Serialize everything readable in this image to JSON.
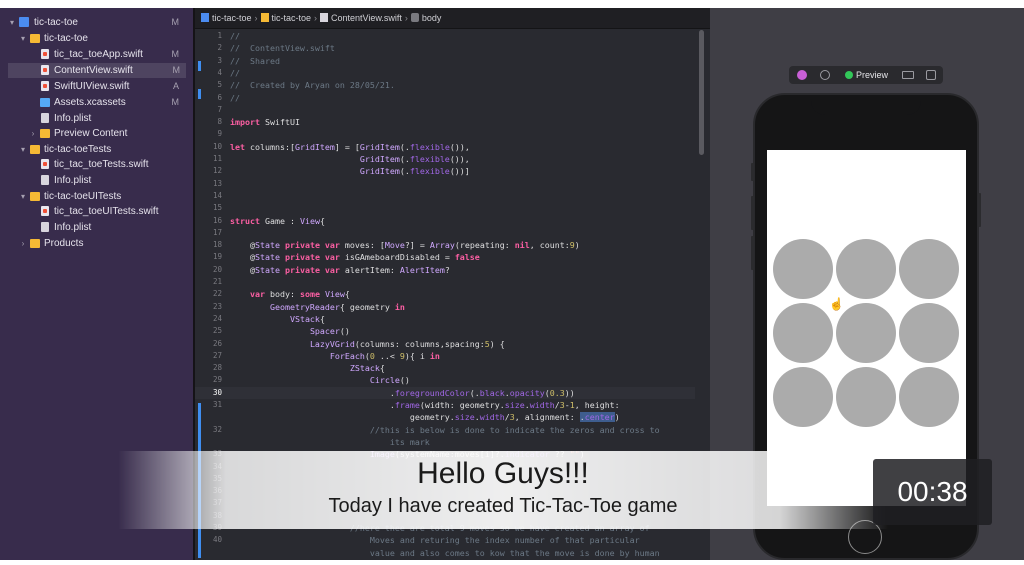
{
  "sidebar": {
    "items": [
      {
        "label": "tic-tac-toe",
        "icon": "app-project-icon",
        "badge": "M",
        "chev": "▾"
      },
      {
        "label": "tic-tac-toe",
        "icon": "folder-icon",
        "badge": "",
        "chev": "▾"
      },
      {
        "label": "tic_tac_toeApp.swift",
        "icon": "swift-file-icon",
        "badge": "M",
        "chev": ""
      },
      {
        "label": "ContentView.swift",
        "icon": "swift-file-icon",
        "badge": "M",
        "chev": ""
      },
      {
        "label": "SwiftUIView.swift",
        "icon": "swift-file-icon",
        "badge": "A",
        "chev": ""
      },
      {
        "label": "Assets.xcassets",
        "icon": "assets-icon",
        "badge": "M",
        "chev": ""
      },
      {
        "label": "Info.plist",
        "icon": "plist-file-icon",
        "badge": "",
        "chev": ""
      },
      {
        "label": "Preview Content",
        "icon": "folder-icon",
        "badge": "",
        "chev": "›"
      },
      {
        "label": "tic-tac-toeTests",
        "icon": "folder-icon",
        "badge": "",
        "chev": "▾"
      },
      {
        "label": "tic_tac_toeTests.swift",
        "icon": "swift-file-icon",
        "badge": "",
        "chev": ""
      },
      {
        "label": "Info.plist",
        "icon": "plist-file-icon",
        "badge": "",
        "chev": ""
      },
      {
        "label": "tic-tac-toeUITests",
        "icon": "folder-icon",
        "badge": "",
        "chev": "▾"
      },
      {
        "label": "tic_tac_toeUITests.swift",
        "icon": "swift-file-icon",
        "badge": "",
        "chev": ""
      },
      {
        "label": "Info.plist",
        "icon": "plist-file-icon",
        "badge": "",
        "chev": ""
      },
      {
        "label": "Products",
        "icon": "folder-icon",
        "badge": "",
        "chev": "›"
      }
    ]
  },
  "jumpbar": {
    "crumbs": [
      "tic-tac-toe",
      "tic-tac-toe",
      "ContentView.swift",
      "body"
    ]
  },
  "preview": {
    "label": "Preview"
  },
  "code": {
    "line_numbers": [
      "1",
      "2",
      "3",
      "4",
      "5",
      "6",
      "7",
      "8",
      "9",
      "10",
      "11",
      "12",
      "13",
      "14",
      "15",
      "16",
      "17",
      "18",
      "19",
      "20",
      "21",
      "22",
      "23",
      "24",
      "25",
      "26",
      "27",
      "28",
      "29",
      "30",
      "31",
      "",
      "32",
      "",
      "33",
      "34",
      "35",
      "36",
      "37",
      "38",
      "39",
      "40",
      "",
      ""
    ]
  },
  "caption": {
    "title": "Hello Guys!!!",
    "subtitle": "Today I have created Tic-Tac-Toe game"
  },
  "timer": "00:38",
  "colors": {
    "accent": "#3f8ef0",
    "sidebar_bg": "#382c4c",
    "editor_bg": "#292a30",
    "keyword": "#fc5fa3",
    "circle_gray": "#ababab"
  }
}
